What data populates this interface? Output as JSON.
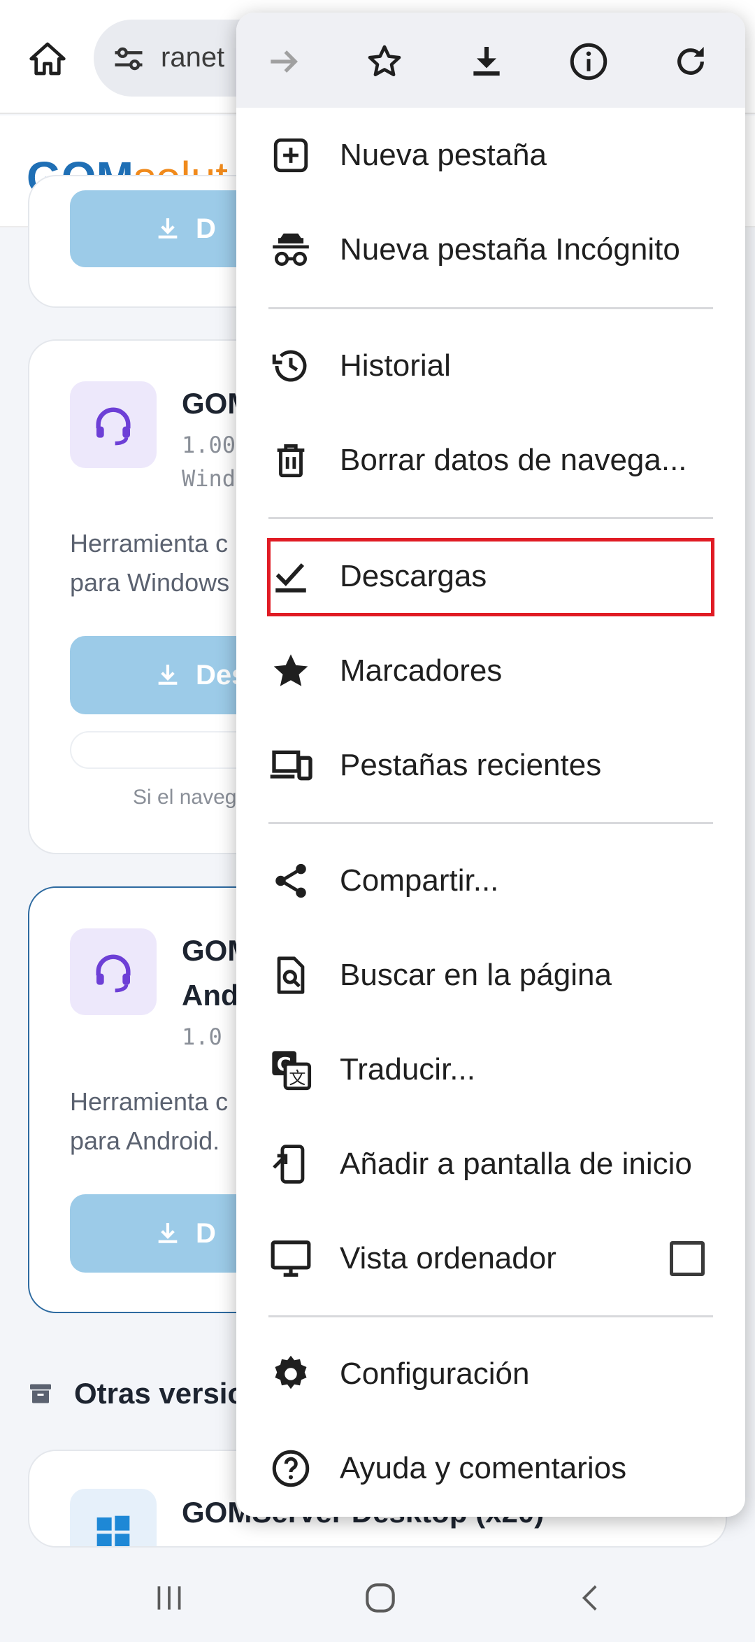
{
  "browser": {
    "url_fragment": "ranet",
    "home_icon": "home-icon",
    "site_settings_icon": "tune-icon"
  },
  "site": {
    "logo_part1": "GOM",
    "logo_part2": "solut"
  },
  "cards": [
    {
      "button_fragment": "D"
    },
    {
      "title_fragment": "GOM",
      "meta_line1": "1.00",
      "meta_line2": "Wind",
      "desc_line1": "Herramienta c",
      "desc_line2": "para Windows",
      "button_fragment": "Des",
      "note_fragment": "Si el naveg"
    },
    {
      "title_line1": "GOM",
      "title_line2": "And",
      "meta_line1": "1.0",
      "desc_line1": "Herramienta c",
      "desc_line2": "para Android.",
      "button_fragment": "D"
    },
    {
      "title_fragment": "GOMServer Desktop (x20)"
    }
  ],
  "section": {
    "title_fragment": "Otras versio"
  },
  "menu": {
    "toolbar": [
      {
        "name": "forward",
        "icon": "arrow-right-icon"
      },
      {
        "name": "bookmark",
        "icon": "star-outline-icon"
      },
      {
        "name": "download",
        "icon": "download-icon"
      },
      {
        "name": "page-info",
        "icon": "info-icon"
      },
      {
        "name": "reload",
        "icon": "refresh-icon"
      }
    ],
    "items": [
      {
        "label": "Nueva pestaña",
        "icon": "new-tab-icon"
      },
      {
        "label": "Nueva pestaña Incógnito",
        "icon": "incognito-icon"
      },
      {
        "label": "Historial",
        "icon": "history-icon"
      },
      {
        "label": "Borrar datos de navega...",
        "icon": "trash-icon"
      },
      {
        "label": "Descargas",
        "icon": "downloads-check-icon"
      },
      {
        "label": "Marcadores",
        "icon": "star-filled-icon"
      },
      {
        "label": "Pestañas recientes",
        "icon": "devices-icon"
      },
      {
        "label": "Compartir...",
        "icon": "share-icon"
      },
      {
        "label": "Buscar en la página",
        "icon": "find-in-page-icon"
      },
      {
        "label": "Traducir...",
        "icon": "translate-icon"
      },
      {
        "label": "Añadir a pantalla de inicio",
        "icon": "add-to-home-icon"
      },
      {
        "label": "Vista ordenador",
        "icon": "desktop-icon",
        "checked": false
      },
      {
        "label": "Configuración",
        "icon": "gear-icon"
      },
      {
        "label": "Ayuda y comentarios",
        "icon": "help-icon"
      }
    ],
    "highlighted_item": "Descargas",
    "highlight_color": "#e01b24"
  },
  "system_nav": {
    "recents_icon": "recents-icon",
    "home_icon": "home-circle-icon",
    "back_icon": "back-icon"
  },
  "colors": {
    "accent_purple": "#6d3fd6",
    "button_blue": "#9ccbe8",
    "logo_blue": "#1f6fb5",
    "logo_orange": "#f08a1c"
  }
}
